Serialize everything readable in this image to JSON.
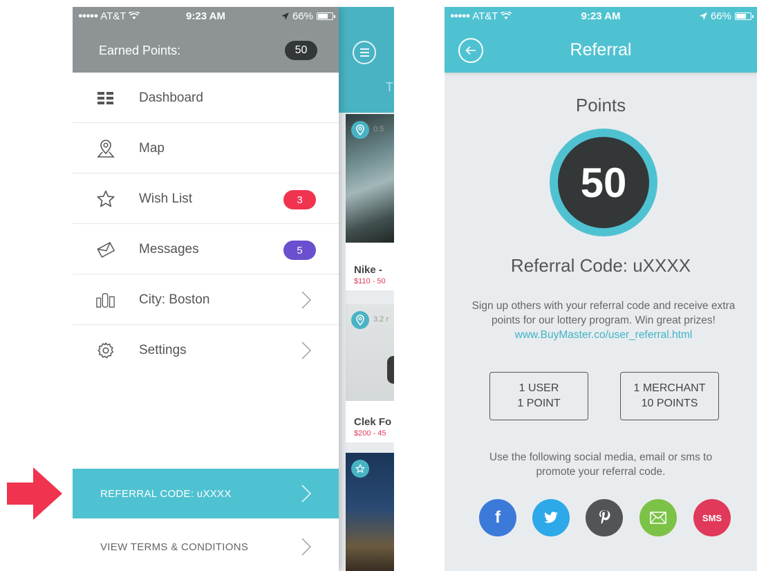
{
  "colors": {
    "accent_teal": "#4fc2d1",
    "header_gray": "#8e9495",
    "dark_badge": "#333738",
    "wish_badge": "#f0334f",
    "messages_badge": "#6a4fcf",
    "arrow_pink": "#f0334f",
    "link_teal": "#3eb4c6"
  },
  "status_bar": {
    "carrier": "AT&T",
    "time": "9:23 AM",
    "battery": "66%"
  },
  "drawer": {
    "earned_label": "Earned Points:",
    "earned_value": "50",
    "menu": [
      {
        "label": "Dashboard",
        "icon": "dashboard-icon"
      },
      {
        "label": "Map",
        "icon": "map-pin-icon"
      },
      {
        "label": "Wish List",
        "icon": "star-icon",
        "badge": "3"
      },
      {
        "label": "Messages",
        "icon": "envelope-icon",
        "badge": "5"
      },
      {
        "label": "City: Boston",
        "icon": "city-icon"
      },
      {
        "label": "Settings",
        "icon": "gear-icon"
      }
    ],
    "referral_label": "REFERRAL CODE: uXXXX",
    "terms_label": "VIEW TERMS & CONDITIONS"
  },
  "background_app": {
    "title_partial": "T",
    "cards": [
      {
        "distance": "0.5",
        "name": "Nike -",
        "price": "$110 - 50"
      },
      {
        "distance": "3.2 r",
        "name": "Clek Fo",
        "price": "$200 - 45"
      }
    ]
  },
  "referral_screen": {
    "title": "Referral",
    "points_heading": "Points",
    "points_value": "50",
    "referral_code": "Referral Code: uXXXX",
    "description": "Sign up others with your referral code and receive extra points for our lottery program. Win great prizes!",
    "link": "www.BuyMaster.co/user_referral.html",
    "rewards": [
      {
        "line1": "1 USER",
        "line2": "1 POINT"
      },
      {
        "line1": "1 MERCHANT",
        "line2": "10 POINTS"
      }
    ],
    "promo_text": "Use the following social media, email or sms to promote your referral code.",
    "social": {
      "facebook": "f",
      "sms": "SMS"
    }
  }
}
